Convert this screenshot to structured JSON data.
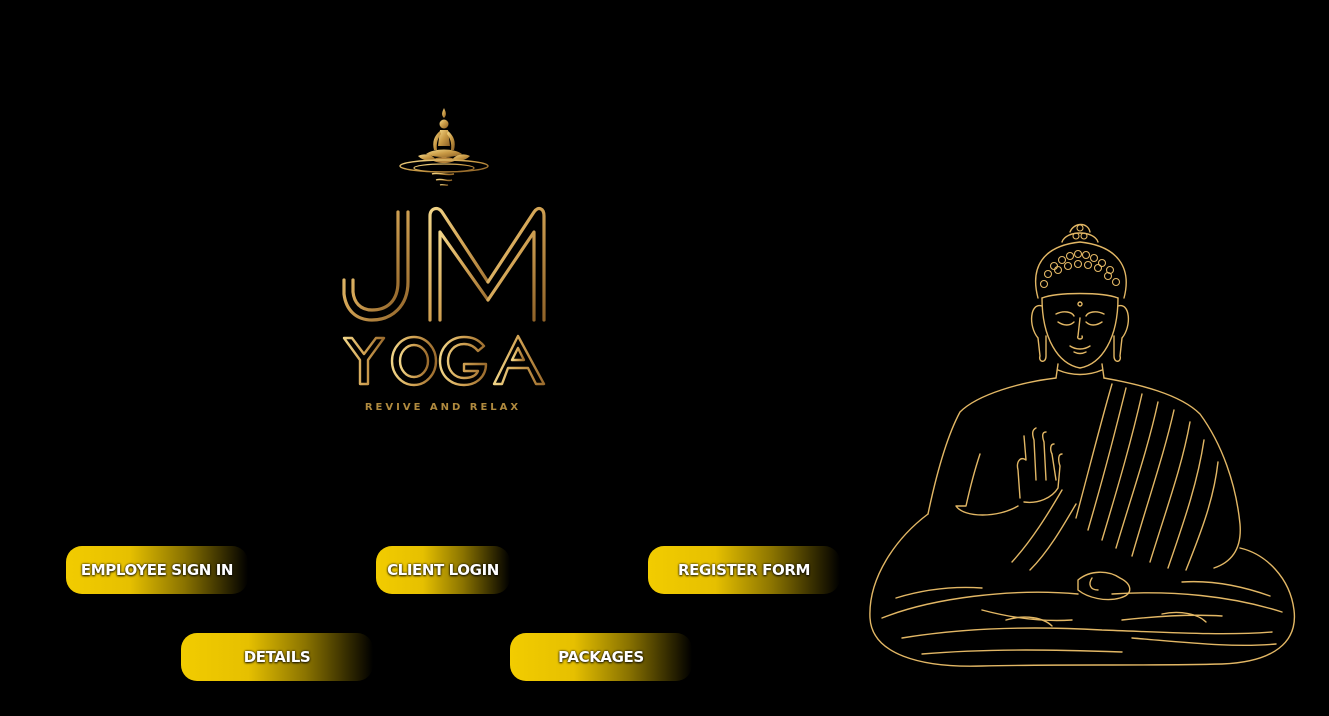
{
  "brand": {
    "name_line1": "JM",
    "name_line2": "YOGA",
    "tagline": "REVIVE AND RELAX",
    "gold_color": "#c9a14a",
    "logo_icon": "meditating-figure-icon"
  },
  "buttons": {
    "employee_sign_in": "EMPLOYEE SIGN IN",
    "client_login": "CLIENT LOGIN",
    "register_form": "REGISTER FORM",
    "details": "DETAILS",
    "packages": "PACKAGES"
  },
  "colors": {
    "background": "#000000",
    "button_gold": "#f2cc00",
    "line_art_gold": "#e2b765",
    "button_text": "#ffffff"
  },
  "illustration": {
    "icon": "buddha-line-art-icon"
  }
}
